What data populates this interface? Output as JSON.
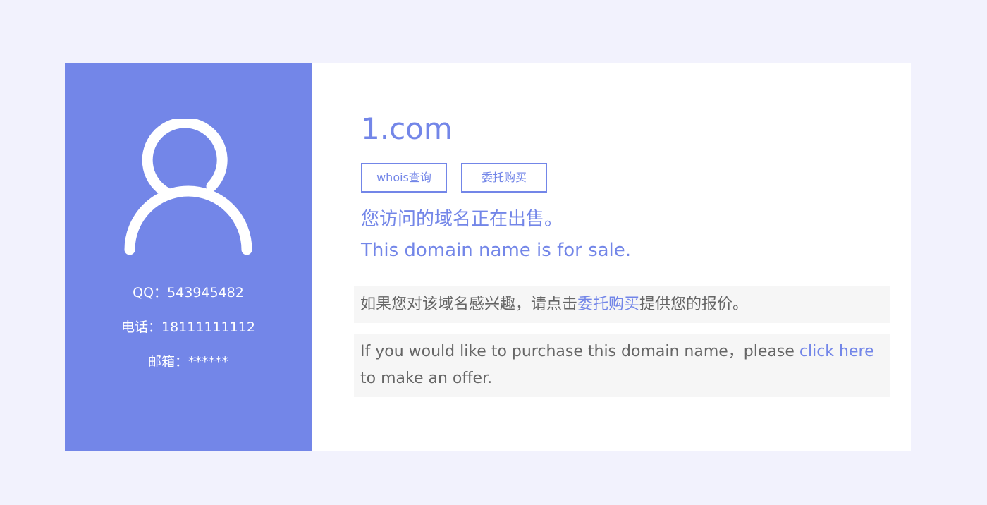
{
  "sidebar": {
    "avatar_icon": "user-icon",
    "qq": "QQ：543945482",
    "phone": "电话：18111111112",
    "email": "邮箱：******"
  },
  "main": {
    "domain": "1.com",
    "whois_button": "whois查询",
    "buy_button": "委托购买",
    "sale_cn": "您访问的域名正在出售。",
    "sale_en": "This domain name is for sale.",
    "info_cn": {
      "before": "如果您对该域名感兴趣，请点击",
      "link": "委托购买",
      "after": "提供您的报价。"
    },
    "info_en": {
      "before": "If you would like to purchase this domain name，please ",
      "link": "click here",
      "after": " to make an offer."
    }
  },
  "colors": {
    "accent": "#7386e8",
    "background": "#f2f2fd",
    "info_bg": "#f6f6f6",
    "text": "#666666"
  }
}
